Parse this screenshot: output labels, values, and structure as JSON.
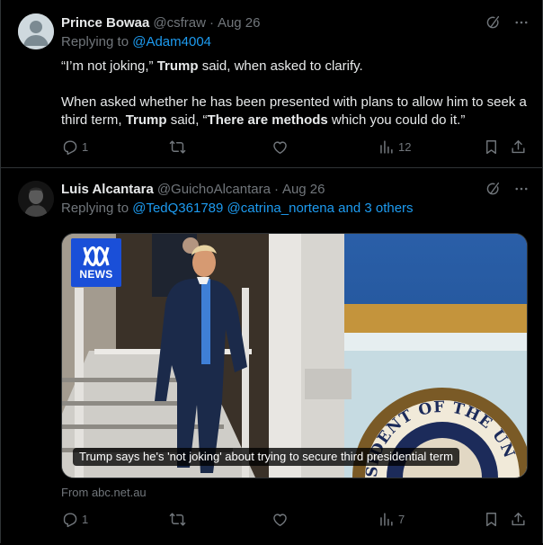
{
  "tweets": [
    {
      "name": "Prince Bowaa",
      "handle": "@csfraw",
      "separator": "·",
      "date": "Aug 26",
      "replying_prefix": "Replying to ",
      "replying_to": "@Adam4004",
      "body": {
        "p1": {
          "a": "“I’m not joking,” ",
          "b": "Trump",
          "c": " said, when asked to clarify."
        },
        "p2": {
          "a": "When asked whether he has been presented with plans to allow him to seek a third term, ",
          "b": "Trump",
          "c": " said, “",
          "d": "There are methods",
          "e": " which you could do it.”"
        }
      },
      "stats": {
        "replies": "1",
        "views": "12"
      }
    },
    {
      "name": "Luis Alcantara",
      "handle": "@GuichoAlcantara",
      "separator": "·",
      "date": "Aug 26",
      "replying_prefix": "Replying to ",
      "replying_to": "@TedQ361789 @catrina_nortena and 3 others",
      "media": {
        "logo_text": "NEWS",
        "caption": "Trump says he's 'not joking' about trying to secure third presidential term",
        "seal_text": "SIDENT OF THE UN"
      },
      "source": "From abc.net.au",
      "stats": {
        "replies": "1",
        "views": "7"
      }
    }
  ],
  "colors": {
    "background": "#000000",
    "text": "#e7e9ea",
    "muted": "#71767b",
    "link": "#1d9bf0",
    "border": "#2f3336",
    "news_blue": "#1a4fd8"
  },
  "icons": [
    "grok-icon",
    "more-icon",
    "reply-icon",
    "repost-icon",
    "like-icon",
    "views-icon",
    "bookmark-icon",
    "share-icon"
  ]
}
